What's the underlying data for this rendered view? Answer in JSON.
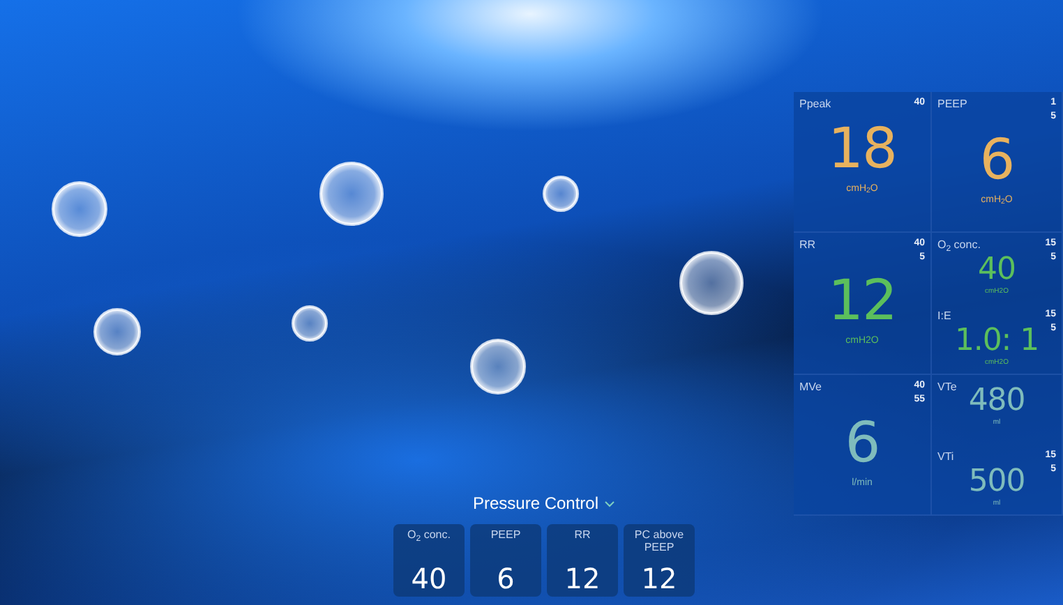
{
  "monitor_panel": [
    {
      "kind": "single",
      "params": [
        {
          "label": "Ppeak",
          "high": "40",
          "value": "18",
          "unit": "cmH$_{2}$O",
          "color": "#e8b25e"
        }
      ]
    },
    {
      "kind": "single",
      "params": [
        {
          "label": "PEEP",
          "high": "1",
          "low": "5",
          "value": "6",
          "unit": "cmH$_{2}$O",
          "color": "#e8b25e"
        }
      ]
    },
    {
      "kind": "single",
      "params": [
        {
          "label": "RR",
          "high": "40",
          "low": "5",
          "value": "12",
          "unit": "cmH2O",
          "color": "#5cbf5c"
        }
      ]
    },
    {
      "kind": "double",
      "params": [
        {
          "label": "O$_{2}$ conc.",
          "high": "15",
          "low": "5",
          "value": "40",
          "unit": "cmH2O",
          "color": "#5cbf5c"
        },
        {
          "label": "I:E",
          "high": "15",
          "low": "5",
          "value": "1.0: 1",
          "unit": "cmH2O",
          "color": "#5cbf5c"
        }
      ]
    },
    {
      "kind": "single",
      "params": [
        {
          "label": "MVe",
          "high": "40",
          "low": "55",
          "value": "6",
          "unit": "l/min",
          "color": "#7fbcbc"
        }
      ]
    },
    {
      "kind": "double",
      "params": [
        {
          "label": "VTe",
          "value": "480",
          "unit": "ml",
          "color": "#7fbcbc"
        },
        {
          "label": "VTi",
          "high": "15",
          "low": "5",
          "value": "500",
          "unit": "ml",
          "color": "#7fbcbc"
        }
      ]
    }
  ],
  "mode": {
    "label": "Pressure Control"
  },
  "settings": [
    {
      "label": "O$_{2}$ conc.",
      "value": "40"
    },
    {
      "label": "PEEP",
      "value": "6"
    },
    {
      "label": "RR",
      "value": "12"
    },
    {
      "label": "PC above PEEP",
      "value": "12"
    }
  ]
}
